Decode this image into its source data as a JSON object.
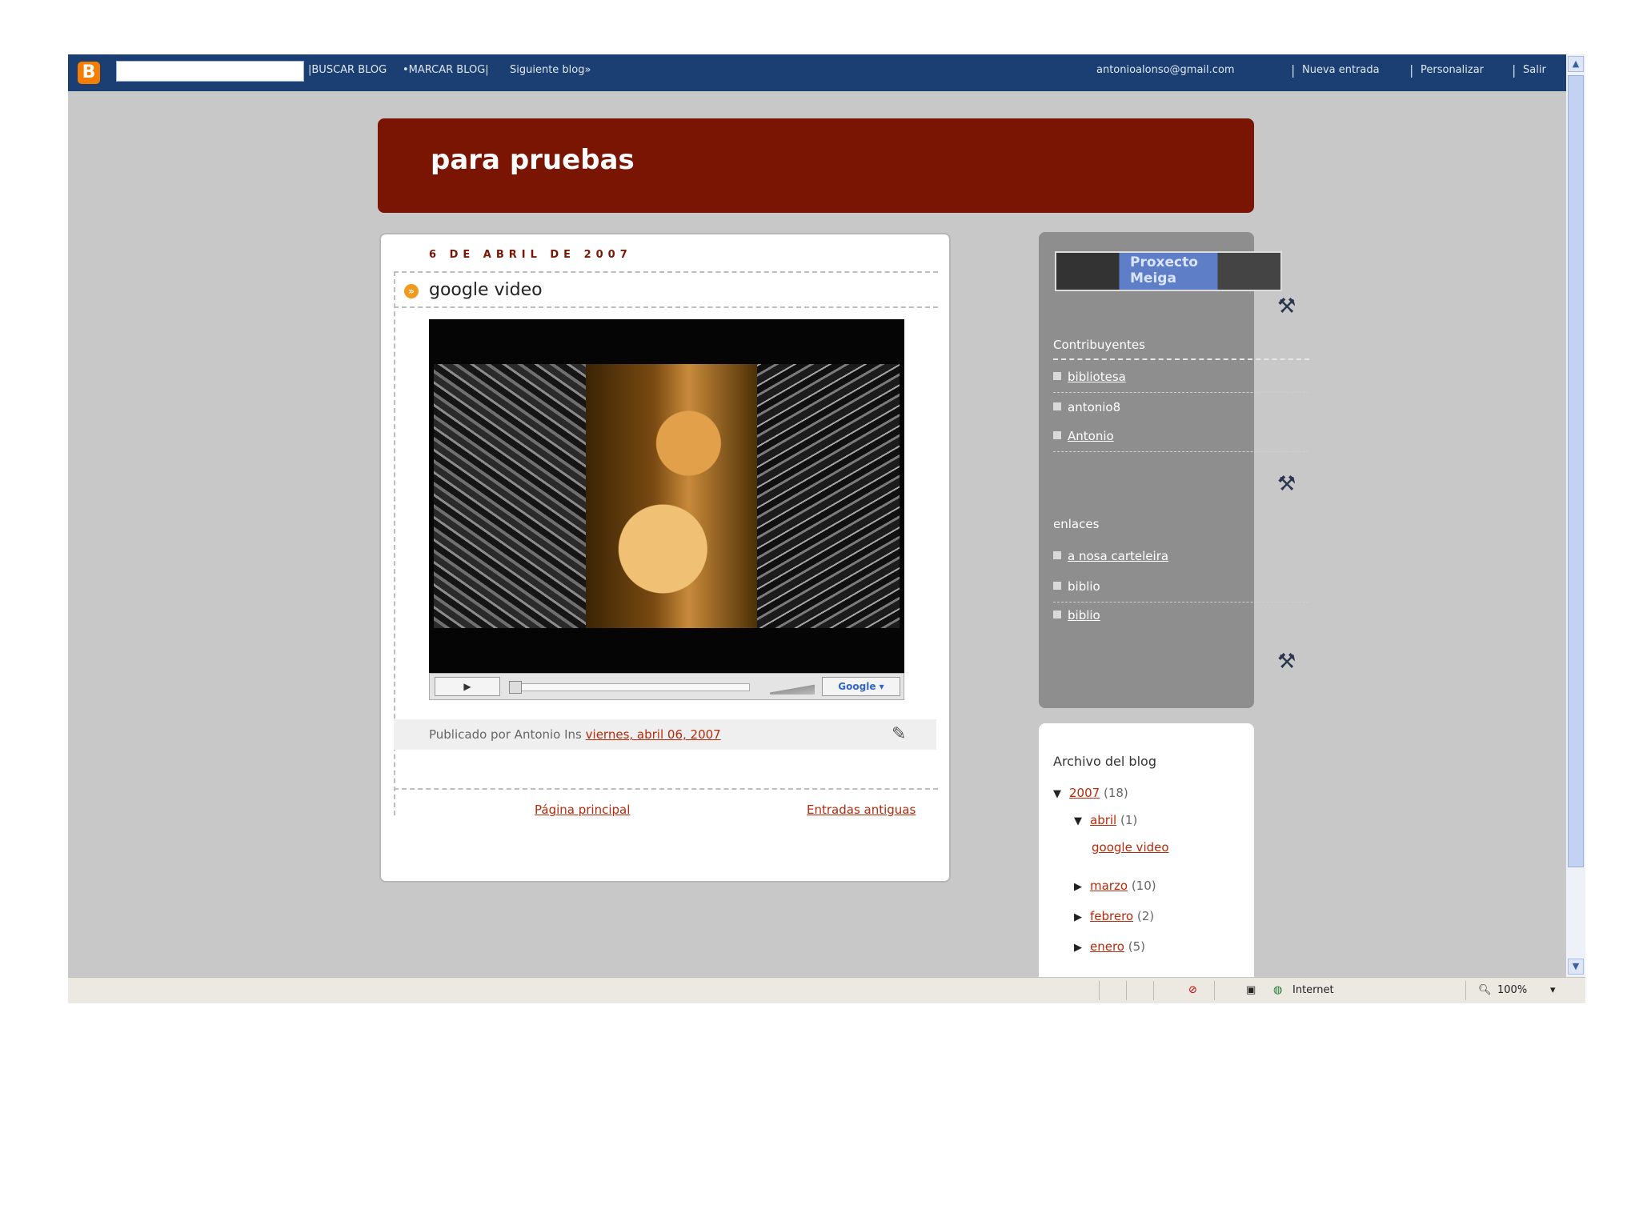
{
  "navbar": {
    "search_value": "",
    "buscar": "|BUSCAR BLOG",
    "marcar": "•MARCAR BLOG|",
    "siguiente": "Siguiente blog»",
    "email": "antonioalonso@gmail.com",
    "nueva_entrada": "Nueva entrada",
    "personalizar": "Personalizar",
    "salir": "Salir",
    "logo": "B"
  },
  "blog": {
    "title": "para pruebas"
  },
  "post": {
    "date": "6 DE ABRIL DE 2007",
    "title": "google video",
    "footer_prefix": "Publicado por Antonio Ins ",
    "footer_link": "viernes, abril 06, 2007",
    "player_logo": "Google ▾",
    "play_symbol": "▶"
  },
  "pager": {
    "home": "Página principal",
    "older": "Entradas antiguas"
  },
  "sidebar": {
    "image_text": "Proxecto Meiga",
    "contributors_heading": "Contribuyentes",
    "contributors": [
      "bibliotesa",
      "antonio8",
      "Antonio"
    ],
    "links_heading": "enlaces",
    "links": [
      "a nosa carteleira",
      "biblio",
      "biblio"
    ]
  },
  "archive": {
    "title": "Archivo del blog",
    "year": "2007",
    "year_count": "(18)",
    "month_open": "abril",
    "month_open_count": "(1)",
    "post_link": "google video",
    "months": [
      {
        "name": "marzo",
        "count": "(10)"
      },
      {
        "name": "febrero",
        "count": "(2)"
      },
      {
        "name": "enero",
        "count": "(5)"
      }
    ]
  },
  "statusbar": {
    "zone": "Internet",
    "zoom": "100%"
  },
  "colors": {
    "header": "#7a1504",
    "navbar": "#1b3f73",
    "link": "#b52a0b",
    "sidebar": "#8e8e8e"
  },
  "icons": [
    "blogger-logo-icon",
    "post-bullet-icon",
    "edit-pencil-icon",
    "tools-icon",
    "globe-icon",
    "zoom-icon"
  ]
}
